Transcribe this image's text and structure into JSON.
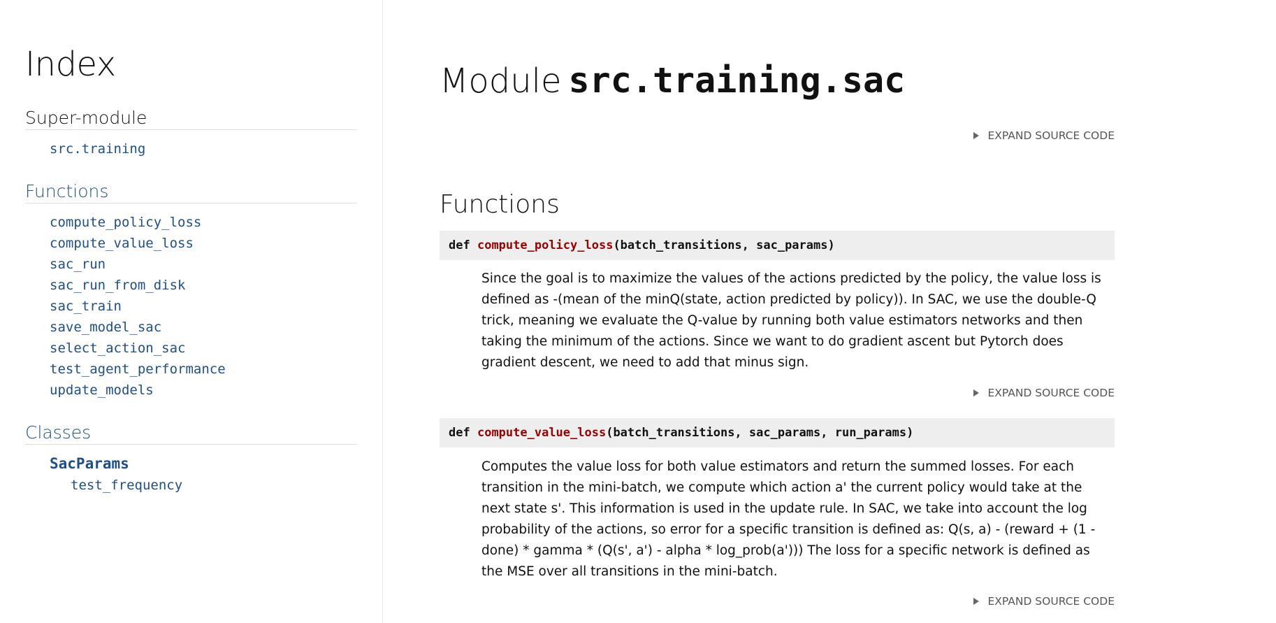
{
  "sidebar": {
    "index_title": "Index",
    "super_module_title": "Super-module",
    "super_module_link": "src.training",
    "functions_title": "Functions",
    "functions": [
      "compute_policy_loss",
      "compute_value_loss",
      "sac_run",
      "sac_run_from_disk",
      "sac_train",
      "save_model_sac",
      "select_action_sac",
      "test_agent_performance",
      "update_models"
    ],
    "classes_title": "Classes",
    "class_name": "SacParams",
    "class_members": [
      "test_frequency"
    ]
  },
  "main": {
    "title_word": "Module",
    "module_name": "src.training.sac",
    "expand_label": "EXPAND SOURCE CODE",
    "functions_heading": "Functions",
    "functions": [
      {
        "keyword": "def",
        "name": "compute_policy_loss",
        "params": "(batch_transitions, sac_params)",
        "doc": "Since the goal is to maximize the values of the actions predicted by the policy, the value loss is defined as -(mean of the minQ(state, action predicted by policy)). In SAC, we use the double-Q trick, meaning we evaluate the Q-value by running both value estimators networks and then taking the minimum of the actions. Since we want to do gradient ascent but Pytorch does gradient descent, we need to add that minus sign."
      },
      {
        "keyword": "def",
        "name": "compute_value_loss",
        "params": "(batch_transitions, sac_params, run_params)",
        "doc": "Computes the value loss for both value estimators and return the summed losses. For each transition in the mini-batch, we compute which action a' the current policy would take at the next state s'. This information is used in the update rule. In SAC, we take into account the log probability of the actions, so error for a specific transition is defined as: Q(s, a) - (reward + (1 - done) * gamma * (Q(s', a') - alpha * log_prob(a'))) The loss for a specific network is defined as the MSE over all transitions in the mini-batch."
      }
    ]
  },
  "colors": {
    "link": "#1f4f86",
    "function_name": "#990000",
    "signature_bg": "#eeeeee"
  }
}
